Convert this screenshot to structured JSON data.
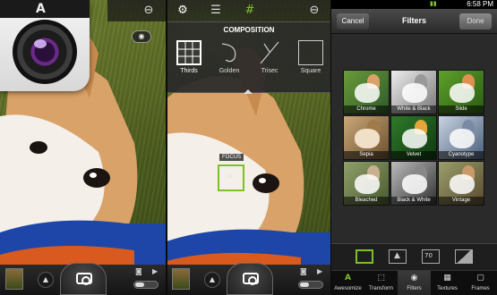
{
  "app_icon": {
    "logo": "A"
  },
  "camera_toolbar": {
    "icons": [
      "capture-mode-icon",
      "settings-gear-icon",
      "adjust-sliders-icon",
      "composition-grid-icon",
      "flash-icon"
    ],
    "active": "composition-grid-icon"
  },
  "composition": {
    "title": "COMPOSITION",
    "options": [
      {
        "label": "Thirds",
        "selected": true
      },
      {
        "label": "Golden",
        "selected": false
      },
      {
        "label": "Trisec",
        "selected": false
      },
      {
        "label": "Square",
        "selected": false
      }
    ]
  },
  "focus": {
    "label": "FOCUS"
  },
  "status_bar": {
    "time": "6:58 PM"
  },
  "filters": {
    "title": "Filters",
    "cancel_label": "Cancel",
    "done_label": "Done",
    "items": [
      {
        "label": "Chrome"
      },
      {
        "label": "White & Black"
      },
      {
        "label": "Slide"
      },
      {
        "label": "Sepia"
      },
      {
        "label": "Velvet"
      },
      {
        "label": "Cyanotype"
      },
      {
        "label": "Bleached"
      },
      {
        "label": "Black & White"
      },
      {
        "label": "Vintage"
      }
    ]
  },
  "tools_row": {
    "badge": "70"
  },
  "bottom_tabs": [
    {
      "label": "Awesomize",
      "icon": "A",
      "active": false
    },
    {
      "label": "Transform",
      "icon": "⬚",
      "active": false
    },
    {
      "label": "Filters",
      "icon": "◉",
      "active": true
    },
    {
      "label": "Textures",
      "icon": "▦",
      "active": false
    },
    {
      "label": "Frames",
      "icon": "▢",
      "active": false
    }
  ]
}
